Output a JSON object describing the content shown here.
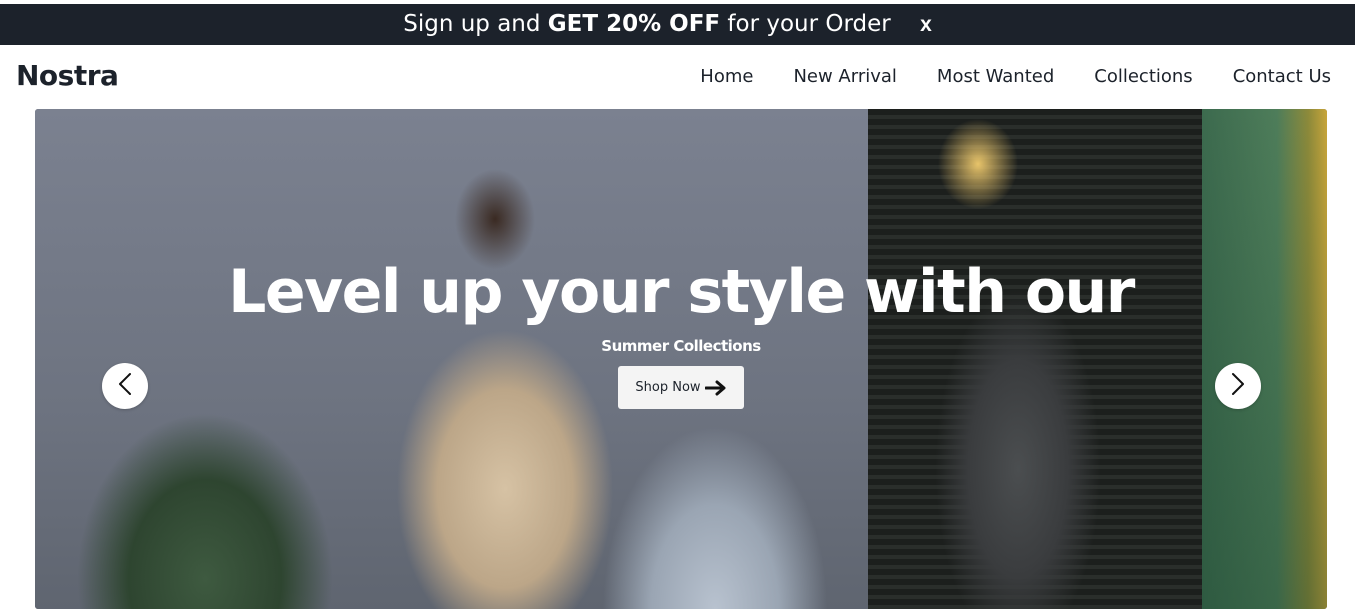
{
  "promo": {
    "prefix": "Sign up and ",
    "highlight": "GET 20% OFF",
    "suffix": " for your Order",
    "close_label": "x"
  },
  "brand": {
    "logo": "Nostra"
  },
  "nav": {
    "items": [
      {
        "label": "Home"
      },
      {
        "label": "New Arrival"
      },
      {
        "label": "Most Wanted"
      },
      {
        "label": "Collections"
      },
      {
        "label": "Contact Us"
      }
    ]
  },
  "hero": {
    "headline": "Level up your style with our",
    "subline": "Summer Collections",
    "cta_label": "Shop Now",
    "cta_icon": "arrow-right-icon",
    "prev_icon": "chevron-left-icon",
    "next_icon": "chevron-right-icon"
  },
  "colors": {
    "promo_bg": "#1c222b",
    "text_dark": "#1c222b",
    "button_bg": "#f4f4f4"
  }
}
